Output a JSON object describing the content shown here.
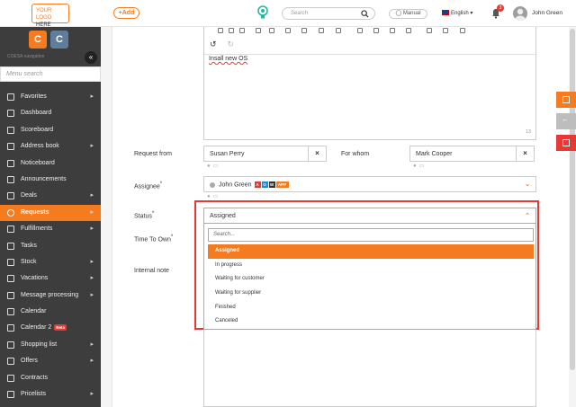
{
  "header": {
    "logo_line1": "YOUR LOGO",
    "logo_line2": "HERE",
    "add_label": "+Add",
    "search_placeholder": "Search",
    "manual_label": "Manual",
    "language": "English",
    "notif_count": "3",
    "user_name": "John Green"
  },
  "sidebar": {
    "caption": "COESA navigation",
    "menu_search_placeholder": "Menu search",
    "beta_label": "Beta",
    "items": [
      {
        "label": "Favorites",
        "chevron": true
      },
      {
        "label": "Dashboard",
        "chevron": false
      },
      {
        "label": "Scoreboard",
        "chevron": false
      },
      {
        "label": "Address book",
        "chevron": true
      },
      {
        "label": "Noticeboard",
        "chevron": false
      },
      {
        "label": "Announcements",
        "chevron": false
      },
      {
        "label": "Deals",
        "chevron": true
      },
      {
        "label": "Requests",
        "chevron": true,
        "active": true
      },
      {
        "label": "Fulfillments",
        "chevron": true
      },
      {
        "label": "Tasks",
        "chevron": false
      },
      {
        "label": "Stock",
        "chevron": true
      },
      {
        "label": "Vacations",
        "chevron": true
      },
      {
        "label": "Message processing",
        "chevron": true
      },
      {
        "label": "Calendar",
        "chevron": false
      },
      {
        "label": "Calendar 2",
        "chevron": false,
        "beta": true
      },
      {
        "label": "Shopping list",
        "chevron": true
      },
      {
        "label": "Offers",
        "chevron": true
      },
      {
        "label": "Contracts",
        "chevron": false
      },
      {
        "label": "Pricelists",
        "chevron": true
      }
    ]
  },
  "editor": {
    "content": "Insall new OS",
    "char_count": "13"
  },
  "form": {
    "request_from_label": "Request from",
    "request_from_value": "Susan Perry",
    "for_whom_label": "For whom",
    "for_whom_value": "Mark Cooper",
    "assignee_label": "Assignee",
    "assignee_value": "John Green",
    "assignee_tags": [
      "A",
      "O",
      "W",
      "APP"
    ],
    "status_label": "Status",
    "status_value": "Assigned",
    "time_to_own_label": "Time To Own",
    "internal_note_label": "Internal note",
    "required_mark": "*"
  },
  "status_dropdown": {
    "search_placeholder": "Search...",
    "options": [
      "Assigned",
      "In progress",
      "Waiting for customer",
      "Waiting for supplier",
      "Finished",
      "Canceled"
    ],
    "selected_index": 0
  },
  "colors": {
    "accent": "#f47b20",
    "danger": "#e53935",
    "sidebar_bg": "#3d3d3d"
  }
}
